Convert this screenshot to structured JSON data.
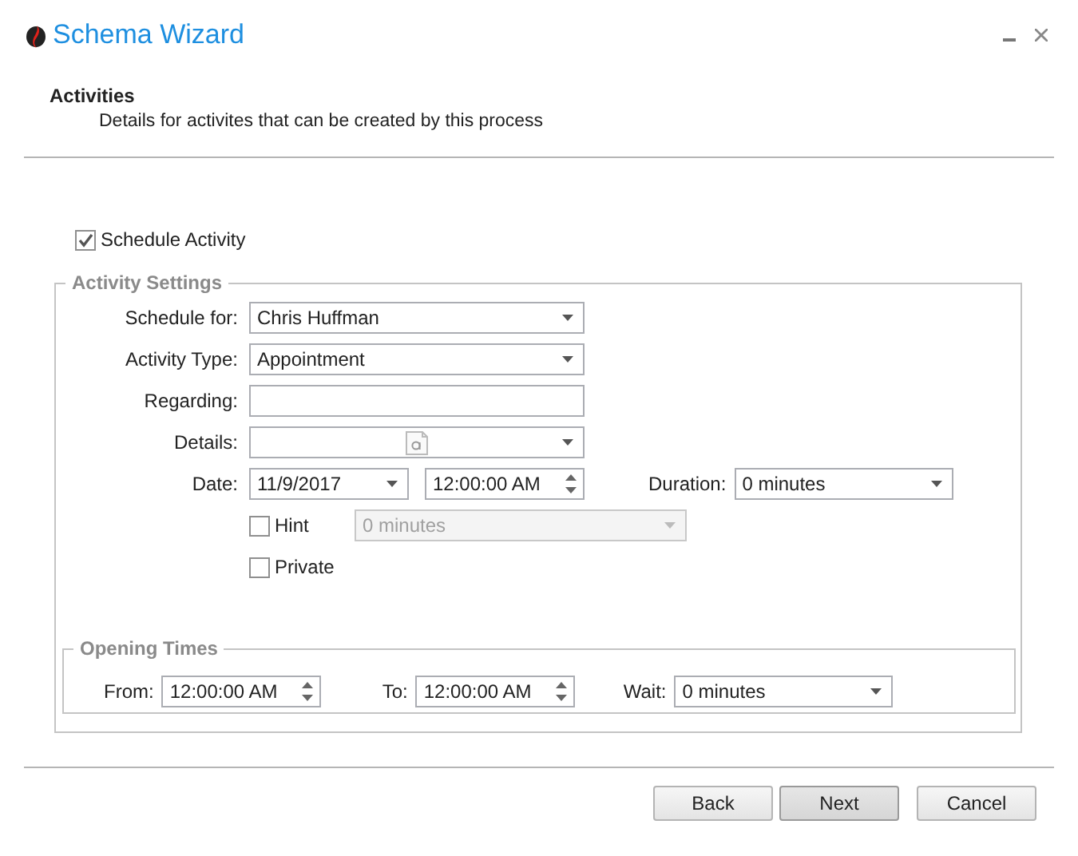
{
  "window": {
    "title": "Schema Wizard"
  },
  "header": {
    "title": "Activities",
    "subtitle": "Details for activites that can be created by this process"
  },
  "schedule_activity": {
    "label": "Schedule Activity",
    "checked": true
  },
  "activity_settings": {
    "legend": "Activity Settings",
    "fields": [
      {
        "kind": "combo",
        "label": "Schedule for:",
        "value": "Chris Huffman"
      },
      {
        "kind": "combo",
        "label": "Activity Type:",
        "value": "Appointment"
      },
      {
        "kind": "text",
        "label": "Regarding:"
      },
      {
        "kind": "details",
        "label": "Details:"
      }
    ],
    "date": {
      "label": "Date:",
      "value": "11/9/2017",
      "time": "12:00:00 AM"
    },
    "duration": {
      "label": "Duration:",
      "value": "0 minutes"
    },
    "hint": {
      "label": "Hint",
      "checked": false,
      "value": "0 minutes",
      "disabled": true
    },
    "private": {
      "label": "Private",
      "checked": false
    }
  },
  "opening_times": {
    "legend": "Opening Times",
    "from": {
      "label": "From:",
      "value": "12:00:00 AM"
    },
    "to": {
      "label": "To:",
      "value": "12:00:00 AM"
    },
    "wait": {
      "label": "Wait:",
      "value": "0 minutes"
    }
  },
  "buttons": [
    {
      "label": "Back",
      "default": false
    },
    {
      "label": "Next",
      "default": true
    },
    {
      "label": "Cancel",
      "default": false
    }
  ]
}
